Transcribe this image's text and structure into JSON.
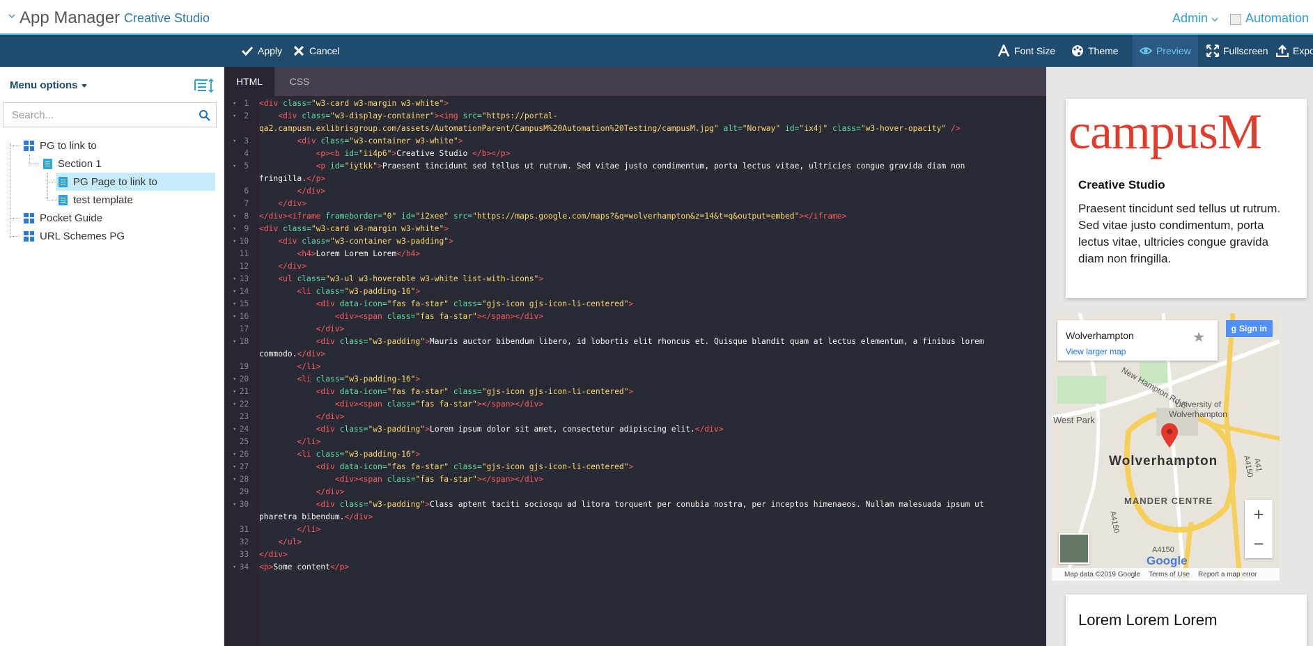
{
  "header": {
    "title": "App Manager",
    "subtitle": "Creative Studio",
    "admin_label": "Admin",
    "automation_label": "Automation"
  },
  "toolbar": {
    "apply": "Apply",
    "cancel": "Cancel",
    "font_size": "Font Size",
    "theme": "Theme",
    "preview": "Preview",
    "fullscreen": "Fullscreen",
    "export": "Expo"
  },
  "sidebar": {
    "menu_options": "Menu options",
    "search_placeholder": "Search...",
    "tree": [
      {
        "label": "PG to link to",
        "icon": "grid-icon"
      },
      {
        "label": "Section 1",
        "icon": "page-icon"
      },
      {
        "label": "PG Page to link to",
        "icon": "page-icon",
        "selected": true
      },
      {
        "label": "test template",
        "icon": "page-icon"
      },
      {
        "label": "Pocket Guide",
        "icon": "grid-icon"
      },
      {
        "label": "URL Schemes PG",
        "icon": "grid-icon"
      }
    ]
  },
  "editor": {
    "tabs": [
      "HTML",
      "CSS"
    ],
    "active_tab": "HTML"
  },
  "preview": {
    "logo_text": "campusM",
    "card_heading": "Creative Studio",
    "card_text": "Praesent tincidunt sed tellus ut rutrum. Sed vitae justo condimentum, porta lectus vitae, ultricies congue gravida diam non fringilla.",
    "map": {
      "place": "Wolverhampton",
      "larger_map": "View larger map",
      "signin": "Sign in",
      "city": "Wolverhampton",
      "labels": [
        "New Hampton Rd E",
        "University of Wolverhampton",
        "West Park",
        "MANDER CENTRE",
        "A4150",
        "A4150",
        "A4150",
        "A41"
      ],
      "footer": [
        "Map data ©2019 Google",
        "Terms of Use",
        "Report a map error"
      ],
      "google": "Google"
    },
    "lorem_heading": "Lorem Lorem Lorem"
  },
  "colors": {
    "toolbar_bg": "#1f4b6e",
    "accent": "#2a9fd6",
    "editor_bg": "#2c2531",
    "selected_row": "#c6ebfa",
    "logo_red": "#e03c2c"
  }
}
